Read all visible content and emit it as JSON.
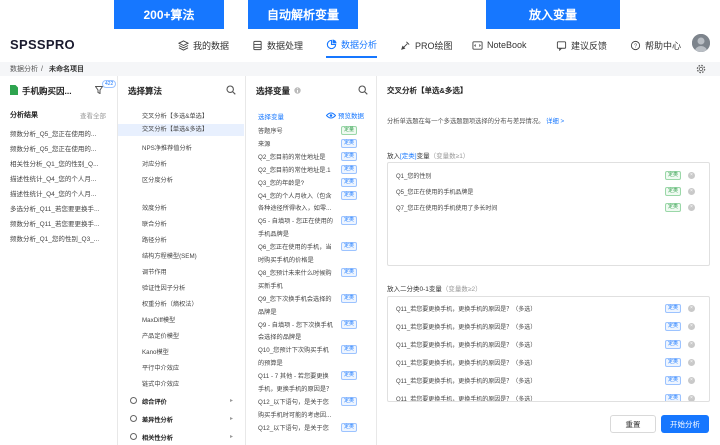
{
  "banners": [
    "200+算法",
    "自动解析变量",
    "放入变量"
  ],
  "brand": "SPSSPRO",
  "nav": {
    "items": [
      "我的数据",
      "数据处理",
      "数据分析",
      "PRO绘图",
      "NoteBook"
    ],
    "feedback": "建议反馈",
    "help": "帮助中心"
  },
  "breadcrumb": {
    "root": "数据分析",
    "sep": "/",
    "current": "未命名项目"
  },
  "project": {
    "title": "手机购买因...",
    "badge": "422",
    "results_label": "分析结果",
    "view_all": "查看全部",
    "items": [
      "频数分析_Q5_您正在使用的...",
      "频数分析_Q5_您正在使用的...",
      "相关性分析_Q1_您的性别_Q...",
      "描述性统计_Q4_您的个人月...",
      "描述性统计_Q4_您的个人月...",
      "多选分析_Q11_若您要更换手...",
      "频数分析_Q11_若您要更换手...",
      "频数分析_Q1_您的性别_Q3_..."
    ]
  },
  "algo": {
    "title": "选择算法",
    "items": [
      "交叉分析【多选&单选】",
      "交叉分析【单选&多选】",
      "NPS净推荐值分析",
      "对应分析",
      "区分度分析",
      "",
      "效度分析",
      "联合分析",
      "路径分析",
      "结构方程模型(SEM)",
      "调节作用",
      "验证性因子分析",
      "权重分析（熵权法）",
      "MaxDiff模型",
      "产品定价模型",
      "Kano模型",
      "平行中介效应",
      "链式中介效应"
    ],
    "groups": [
      "综合评价",
      "差异性分析",
      "相关性分析"
    ]
  },
  "vars": {
    "title": "选择变量",
    "sub": "选择变量",
    "preview": "预览数据",
    "tag_cat": "定类",
    "tag_cont": "定量",
    "items": [
      {
        "text": "答题序号",
        "tag": "定量",
        "t": "g"
      },
      {
        "text": "来源",
        "tag": "定类",
        "t": "b"
      },
      {
        "text": "Q2_您目前的常住地址是",
        "tag": "定类",
        "t": "b"
      },
      {
        "text": "Q2_您目前的常住地址是.1",
        "tag": "定类",
        "t": "b"
      },
      {
        "text": "Q3_您的年龄是?",
        "tag": "定类",
        "t": "b"
      },
      {
        "text": "Q4_您的个人月收入（包含",
        "tag": "定类",
        "t": "b"
      },
      {
        "text": "各种途径所得收入，如零...",
        "tag": "",
        "t": ""
      },
      {
        "text": "Q5 - 自填项 - 您正在使用的",
        "tag": "定类",
        "t": "b"
      },
      {
        "text": "手机品牌是",
        "tag": "",
        "t": ""
      },
      {
        "text": "Q6_您正在使用的手机，当",
        "tag": "定类",
        "t": "b"
      },
      {
        "text": "时购买手机的价格是",
        "tag": "",
        "t": ""
      },
      {
        "text": "Q8_您预计未来什么时候购",
        "tag": "定类",
        "t": "b"
      },
      {
        "text": "买新手机",
        "tag": "",
        "t": ""
      },
      {
        "text": "Q9_您下次换手机会选择的",
        "tag": "定类",
        "t": "b"
      },
      {
        "text": "品牌是",
        "tag": "",
        "t": ""
      },
      {
        "text": "Q9 - 自填项 - 您下次换手机",
        "tag": "定类",
        "t": "b"
      },
      {
        "text": "会选择的品牌是",
        "tag": "",
        "t": ""
      },
      {
        "text": "Q10_您预计下次购买手机",
        "tag": "定类",
        "t": "b"
      },
      {
        "text": "的预算是",
        "tag": "",
        "t": ""
      },
      {
        "text": "Q11 - 7 其他 - 若您要更换",
        "tag": "定类",
        "t": "b"
      },
      {
        "text": "手机，更换手机的原因是？",
        "tag": "",
        "t": ""
      },
      {
        "text": "Q12_以下语句，是关于您",
        "tag": "定类",
        "t": "b"
      },
      {
        "text": "购买手机时可能的考虑因...",
        "tag": "",
        "t": ""
      },
      {
        "text": "Q12_以下语句，是关于您",
        "tag": "定类",
        "t": "b"
      }
    ]
  },
  "analysis": {
    "title": "交叉分析【单选&多选】",
    "desc": "分析单选题在每一个多选题题项选择的分布与差异情况。",
    "detail": "详细 >",
    "box1_label_pre": "放入",
    "box1_label_type": "[定类]",
    "box1_label_post": "变量",
    "box1_hint": "（变量数≥1）",
    "box1_items": [
      {
        "text": "Q1_您的性别",
        "tag": "定类"
      },
      {
        "text": "Q5_您正在使用的手机品牌是",
        "tag": "定类"
      },
      {
        "text": "Q7_您正在使用的手机使用了多长时间",
        "tag": "定类"
      }
    ],
    "box2_label": "放入二分类0-1变量",
    "box2_hint": "（变量数≥2）",
    "box2_items": [
      {
        "text": "Q11_若您要更换手机，更换手机的原因是？（多选）",
        "tag": "定类"
      },
      {
        "text": "Q11_若您要更换手机，更换手机的原因是？（多选）",
        "tag": "定类"
      },
      {
        "text": "Q11_若您要更换手机，更换手机的原因是？（多选）",
        "tag": "定类"
      },
      {
        "text": "Q11_若您要更换手机，更换手机的原因是？（多选）",
        "tag": "定类"
      },
      {
        "text": "Q11_若您要更换手机，更换手机的原因是？（多选）",
        "tag": "定类"
      },
      {
        "text": "Q11_若您要更换手机，更换手机的原因是？（多选）",
        "tag": "定类"
      }
    ],
    "reset": "重置",
    "start": "开始分析"
  },
  "colors": {
    "accent": "#1677ff",
    "banner": "#1677ff"
  }
}
